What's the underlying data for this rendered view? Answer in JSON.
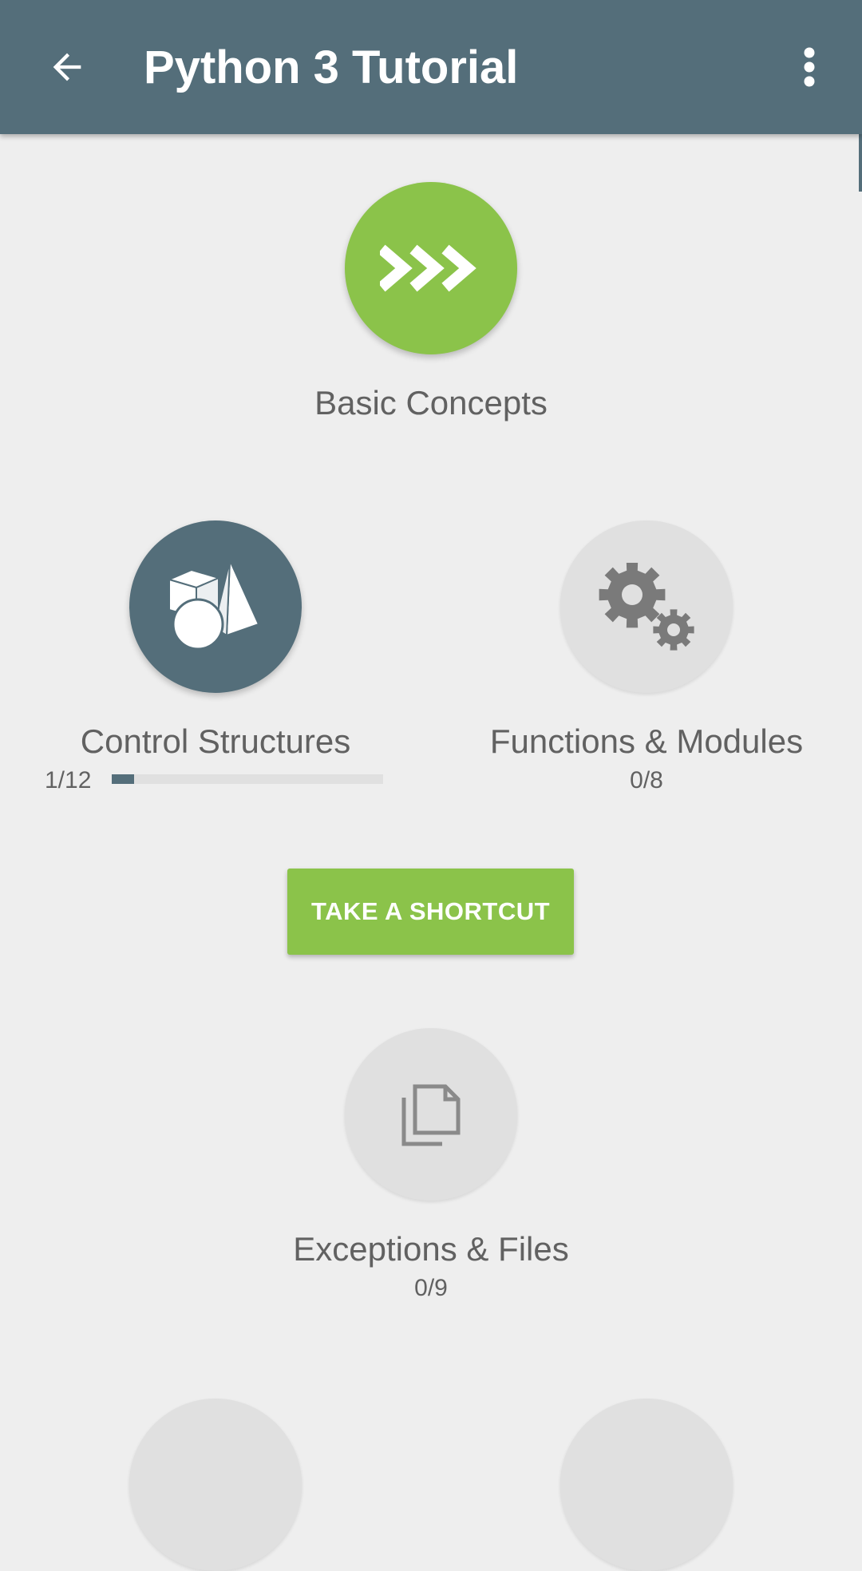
{
  "app_bar": {
    "title": "Python 3 Tutorial",
    "back_icon": "arrow-back-icon",
    "menu_icon": "more-vert-icon",
    "color": "#546e7a"
  },
  "modules": {
    "basic_concepts": {
      "label": "Basic Concepts",
      "icon": "chevrons-right-icon",
      "state": "completed",
      "color": "#8bc34a"
    },
    "control_structures": {
      "label": "Control Structures",
      "progress_text": "1/12",
      "progress_fraction": 0.0833,
      "icon": "geometric-shapes-icon",
      "state": "in-progress",
      "color": "#546e7a"
    },
    "functions_modules": {
      "label": "Functions & Modules",
      "progress_text": "0/8",
      "icon": "gears-icon",
      "state": "locked"
    },
    "exceptions_files": {
      "label": "Exceptions & Files",
      "progress_text": "0/9",
      "icon": "documents-icon",
      "state": "locked"
    }
  },
  "shortcut_button": {
    "label": "TAKE A SHORTCUT",
    "color": "#8bc34a"
  }
}
